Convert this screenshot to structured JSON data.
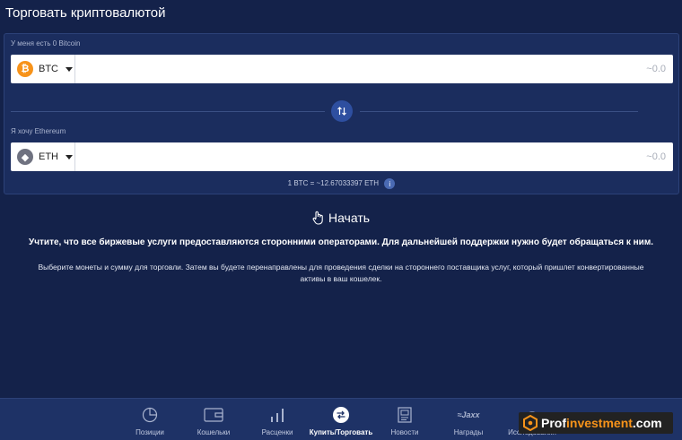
{
  "page": {
    "title": "Торговать криптовалютой"
  },
  "from": {
    "label": "У меня есть 0 Bitcoin",
    "coin_code": "BTC",
    "coin_symbol": "₿",
    "amount_placeholder": "~0.0"
  },
  "to": {
    "label": "Я хочу Ethereum",
    "coin_code": "ETH",
    "coin_symbol": "◆",
    "amount_placeholder": "~0.0"
  },
  "rate": {
    "text": "1 BTC = ~12.67033397 ETH",
    "info_symbol": "i"
  },
  "start": {
    "label": "Начать"
  },
  "notice": "Учтите, что все биржевые услуги предоставляются сторонними операторами. Для дальнейшей поддержки нужно будет обращаться к ним.",
  "instructions": "Выберите монеты и сумму для торговли. Затем вы будете перенаправлены для проведения сделки на стороннего поставщика услуг, который пришлет конвертированные активы в ваш кошелек.",
  "nav": {
    "items": [
      {
        "label": "Позиции",
        "icon": "pie-chart-icon"
      },
      {
        "label": "Кошельки",
        "icon": "wallet-icon"
      },
      {
        "label": "Расценки",
        "icon": "bar-chart-icon"
      },
      {
        "label": "Купить/Торговать",
        "icon": "exchange-icon",
        "active": true
      },
      {
        "label": "Новости",
        "icon": "news-icon"
      },
      {
        "label": "Награды",
        "icon": "jaxx-icon",
        "icon_text": "≈Jaxx"
      },
      {
        "label": "Исследования",
        "icon": "research-icon"
      }
    ]
  },
  "watermark": {
    "prefix": "Prof",
    "accent": "investment",
    "suffix": ".com"
  },
  "colors": {
    "background": "#14224a",
    "panel": "#1b2d5e",
    "btc": "#f7931a",
    "accent_blue": "#2e4fa0"
  }
}
